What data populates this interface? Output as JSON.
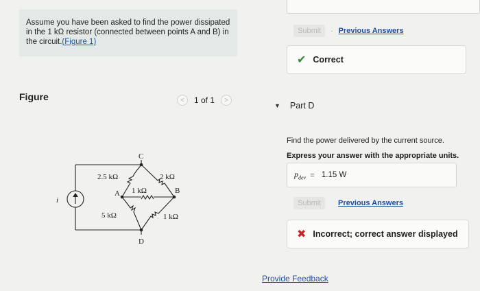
{
  "problem": {
    "text_before": "Assume you have been asked to find the power dissipated in the 1 kΩ resistor (connected between points A and B) in the circuit.",
    "figure_link": "(Figure 1)"
  },
  "figure": {
    "label": "Figure",
    "pager": "1 of 1",
    "prev_glyph": "<",
    "next_glyph": ">"
  },
  "circuit": {
    "r_ac": "2.5 kΩ",
    "r_cb": "2 kΩ",
    "r_ab": "1 kΩ",
    "r_ad": "5 kΩ",
    "r_bd": "1 kΩ",
    "node_a": "A",
    "node_b": "B",
    "node_c": "C",
    "node_d": "D",
    "source": "i"
  },
  "previous_part": {
    "submit_label": "Submit",
    "previous_answers": "Previous Answers",
    "feedback": "Correct",
    "feedback_color": "#2f8a3a"
  },
  "part_d": {
    "title": "Part D",
    "instruction": "Find the power delivered by the current source.",
    "express": "Express your answer with the appropriate units.",
    "answer_label": "p",
    "answer_sub": "dev",
    "equals": "=",
    "answer_value": "1.15 W",
    "submit_label": "Submit",
    "previous_answers": "Previous Answers",
    "feedback": "Incorrect; correct answer displayed",
    "feedback_color": "#c8222a"
  },
  "provide_feedback": "Provide Feedback"
}
